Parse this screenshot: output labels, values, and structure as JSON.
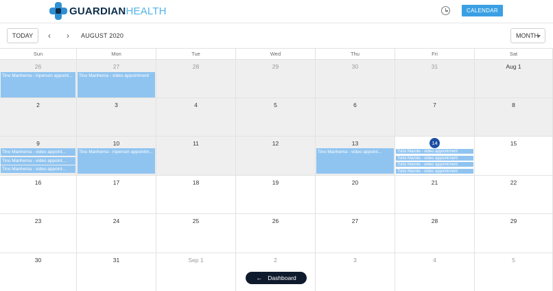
{
  "header": {
    "logo_bold": "GUARDIAN",
    "logo_light": "HEALTH",
    "calendar_button": "CALENDAR"
  },
  "toolbar": {
    "today": "TODAY",
    "prev": "‹",
    "next": "›",
    "month_label": "AUGUST 2020",
    "view": "MONTH"
  },
  "weekdays": [
    "Sun",
    "Mon",
    "Tue",
    "Wed",
    "Thu",
    "Fri",
    "Sat"
  ],
  "weeks": [
    [
      {
        "d": "26",
        "other": true,
        "shaded": true,
        "events": [
          "Tino Manhema - inperson appoint..."
        ]
      },
      {
        "d": "27",
        "other": true,
        "shaded": true,
        "events": [
          "Tino Manhema - video appointment"
        ]
      },
      {
        "d": "28",
        "other": true,
        "shaded": true,
        "events": []
      },
      {
        "d": "29",
        "other": true,
        "shaded": true,
        "events": []
      },
      {
        "d": "30",
        "other": true,
        "shaded": true,
        "events": []
      },
      {
        "d": "31",
        "other": true,
        "shaded": true,
        "events": []
      },
      {
        "d": "Aug 1",
        "other": false,
        "shaded": true,
        "events": []
      }
    ],
    [
      {
        "d": "2",
        "other": false,
        "shaded": true,
        "events": []
      },
      {
        "d": "3",
        "other": false,
        "shaded": true,
        "events": []
      },
      {
        "d": "4",
        "other": false,
        "shaded": true,
        "events": []
      },
      {
        "d": "5",
        "other": false,
        "shaded": true,
        "events": []
      },
      {
        "d": "6",
        "other": false,
        "shaded": true,
        "events": []
      },
      {
        "d": "7",
        "other": false,
        "shaded": true,
        "events": []
      },
      {
        "d": "8",
        "other": false,
        "shaded": true,
        "events": []
      }
    ],
    [
      {
        "d": "9",
        "other": false,
        "shaded": true,
        "events": [
          "Tino Manhema - video appoint...",
          "Tino Manhema - video appoint...",
          "Tino Manhema - video appoint..."
        ]
      },
      {
        "d": "10",
        "other": false,
        "shaded": true,
        "events": [
          "Tino Manhema - inperson appointm..."
        ]
      },
      {
        "d": "11",
        "other": false,
        "shaded": true,
        "events": []
      },
      {
        "d": "12",
        "other": false,
        "shaded": true,
        "events": []
      },
      {
        "d": "13",
        "other": false,
        "shaded": true,
        "events": [
          "Tino Manhema - video appoint..."
        ]
      },
      {
        "d": "14",
        "other": false,
        "shaded": false,
        "today": true,
        "events": [
          "Tsitsi Marote - video appointment",
          "Tsitsi Marote - video appointment",
          "Tsitsi Marote - video appointment",
          "Tsitsi Marote - video appointment"
        ]
      },
      {
        "d": "15",
        "other": false,
        "shaded": false,
        "events": []
      }
    ],
    [
      {
        "d": "16",
        "other": false,
        "shaded": false,
        "events": []
      },
      {
        "d": "17",
        "other": false,
        "shaded": false,
        "events": []
      },
      {
        "d": "18",
        "other": false,
        "shaded": false,
        "events": []
      },
      {
        "d": "19",
        "other": false,
        "shaded": false,
        "events": []
      },
      {
        "d": "20",
        "other": false,
        "shaded": false,
        "events": []
      },
      {
        "d": "21",
        "other": false,
        "shaded": false,
        "events": []
      },
      {
        "d": "22",
        "other": false,
        "shaded": false,
        "events": []
      }
    ],
    [
      {
        "d": "23",
        "other": false,
        "shaded": false,
        "events": []
      },
      {
        "d": "24",
        "other": false,
        "shaded": false,
        "events": []
      },
      {
        "d": "25",
        "other": false,
        "shaded": false,
        "events": []
      },
      {
        "d": "26",
        "other": false,
        "shaded": false,
        "events": []
      },
      {
        "d": "27",
        "other": false,
        "shaded": false,
        "events": []
      },
      {
        "d": "28",
        "other": false,
        "shaded": false,
        "events": []
      },
      {
        "d": "29",
        "other": false,
        "shaded": false,
        "events": []
      }
    ],
    [
      {
        "d": "30",
        "other": false,
        "shaded": false,
        "events": []
      },
      {
        "d": "31",
        "other": false,
        "shaded": false,
        "events": []
      },
      {
        "d": "Sep 1",
        "other": true,
        "shaded": false,
        "events": []
      },
      {
        "d": "2",
        "other": true,
        "shaded": false,
        "events": []
      },
      {
        "d": "3",
        "other": true,
        "shaded": false,
        "events": []
      },
      {
        "d": "4",
        "other": true,
        "shaded": false,
        "events": []
      },
      {
        "d": "5",
        "other": true,
        "shaded": false,
        "events": []
      }
    ]
  ],
  "dashboard_button": "Dashboard",
  "colors": {
    "accent": "#3aa0e3",
    "event": "#90c4f0",
    "today_badge": "#1a4fa3",
    "dark": "#0f1b2d"
  }
}
